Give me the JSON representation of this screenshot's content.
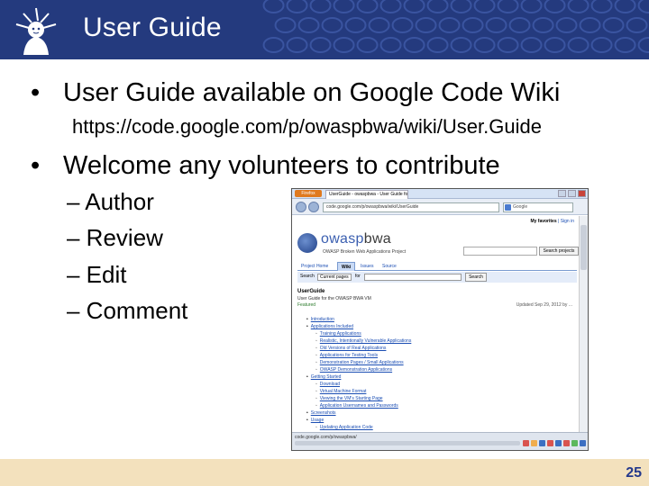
{
  "slide": {
    "title": "User Guide",
    "bullets": [
      "User Guide available on Google Code Wiki",
      "Welcome any volunteers to contribute"
    ],
    "url_text": "https://code.google.com/p/owaspbwa/wiki/User.Guide",
    "sub_bullets": [
      "– Author",
      "– Review",
      "– Edit",
      "– Comment"
    ],
    "page_number": "25",
    "bullet_glyph": "•"
  },
  "screenshot": {
    "browser_button": "Firefox",
    "tab_title": "UserGuide - owaspbwa - User Guide for...",
    "address": "code.google.com/p/owaspbwa/wiki/UserGuide",
    "search_engine": "Google",
    "user_links": [
      "My favorites",
      "Sign in"
    ],
    "project_name_prefix": "owasp",
    "project_name_suffix": "bwa",
    "project_desc": "OWASP Broken Web Applications Project",
    "project_search_button": "Search projects",
    "tabs": [
      "Project Home",
      "Wiki",
      "Issues",
      "Source"
    ],
    "search_label": "Search",
    "search_scope": "Current pages",
    "search_for": "for",
    "search_button": "Search",
    "wiki_title": "UserGuide",
    "wiki_subtitle": "User Guide for the OWASP BWA VM",
    "wiki_featured": "Featured",
    "wiki_updated": "Updated Sep 29, 2012 by ...",
    "toc": [
      {
        "level": 1,
        "text": "Introduction"
      },
      {
        "level": 1,
        "text": "Applications Included"
      },
      {
        "level": 2,
        "text": "Training Applications"
      },
      {
        "level": 2,
        "text": "Realistic, Intentionally Vulnerable Applications"
      },
      {
        "level": 2,
        "text": "Old Versions of Real Applications"
      },
      {
        "level": 2,
        "text": "Applications for Testing Tools"
      },
      {
        "level": 2,
        "text": "Demonstration Pages / Small Applications"
      },
      {
        "level": 2,
        "text": "OWASP Demonstration Applications"
      },
      {
        "level": 1,
        "text": "Getting Started"
      },
      {
        "level": 2,
        "text": "Download"
      },
      {
        "level": 2,
        "text": "Virtual Machine Format"
      },
      {
        "level": 2,
        "text": "Viewing the VM's Starting Page"
      },
      {
        "level": 2,
        "text": "Application Usernames and Passwords"
      },
      {
        "level": 1,
        "text": "Screenshots"
      },
      {
        "level": 1,
        "text": "Usage"
      },
      {
        "level": 2,
        "text": "Updating Application Code"
      }
    ],
    "status_url": "code.google.com/p/owaspbwa/",
    "status_icon_colors": [
      "#d9534f",
      "#f0ad4e",
      "#3b6fc2",
      "#d9534f",
      "#3b6fc2",
      "#d9534f",
      "#5cb85c",
      "#3b6fc2"
    ]
  },
  "colors": {
    "header_bg": "#243a7e",
    "footer_bg": "#f3e1bd",
    "page_number": "#24398c"
  }
}
